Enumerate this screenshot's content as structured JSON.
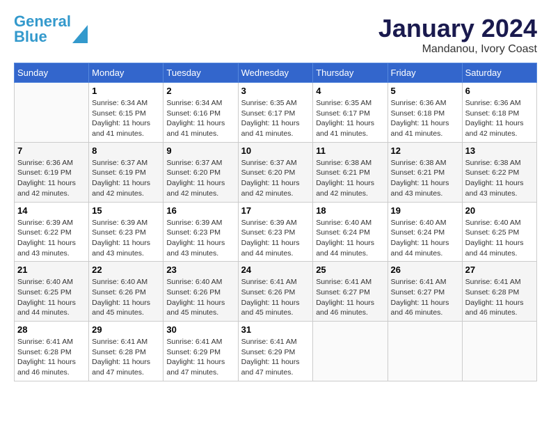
{
  "logo": {
    "line1": "General",
    "line2": "Blue"
  },
  "title": "January 2024",
  "subtitle": "Mandanou, Ivory Coast",
  "weekdays": [
    "Sunday",
    "Monday",
    "Tuesday",
    "Wednesday",
    "Thursday",
    "Friday",
    "Saturday"
  ],
  "weeks": [
    [
      {
        "day": "",
        "sunrise": "",
        "sunset": "",
        "daylight": ""
      },
      {
        "day": "1",
        "sunrise": "Sunrise: 6:34 AM",
        "sunset": "Sunset: 6:15 PM",
        "daylight": "Daylight: 11 hours and 41 minutes."
      },
      {
        "day": "2",
        "sunrise": "Sunrise: 6:34 AM",
        "sunset": "Sunset: 6:16 PM",
        "daylight": "Daylight: 11 hours and 41 minutes."
      },
      {
        "day": "3",
        "sunrise": "Sunrise: 6:35 AM",
        "sunset": "Sunset: 6:17 PM",
        "daylight": "Daylight: 11 hours and 41 minutes."
      },
      {
        "day": "4",
        "sunrise": "Sunrise: 6:35 AM",
        "sunset": "Sunset: 6:17 PM",
        "daylight": "Daylight: 11 hours and 41 minutes."
      },
      {
        "day": "5",
        "sunrise": "Sunrise: 6:36 AM",
        "sunset": "Sunset: 6:18 PM",
        "daylight": "Daylight: 11 hours and 41 minutes."
      },
      {
        "day": "6",
        "sunrise": "Sunrise: 6:36 AM",
        "sunset": "Sunset: 6:18 PM",
        "daylight": "Daylight: 11 hours and 42 minutes."
      }
    ],
    [
      {
        "day": "7",
        "sunrise": "Sunrise: 6:36 AM",
        "sunset": "Sunset: 6:19 PM",
        "daylight": "Daylight: 11 hours and 42 minutes."
      },
      {
        "day": "8",
        "sunrise": "Sunrise: 6:37 AM",
        "sunset": "Sunset: 6:19 PM",
        "daylight": "Daylight: 11 hours and 42 minutes."
      },
      {
        "day": "9",
        "sunrise": "Sunrise: 6:37 AM",
        "sunset": "Sunset: 6:20 PM",
        "daylight": "Daylight: 11 hours and 42 minutes."
      },
      {
        "day": "10",
        "sunrise": "Sunrise: 6:37 AM",
        "sunset": "Sunset: 6:20 PM",
        "daylight": "Daylight: 11 hours and 42 minutes."
      },
      {
        "day": "11",
        "sunrise": "Sunrise: 6:38 AM",
        "sunset": "Sunset: 6:21 PM",
        "daylight": "Daylight: 11 hours and 42 minutes."
      },
      {
        "day": "12",
        "sunrise": "Sunrise: 6:38 AM",
        "sunset": "Sunset: 6:21 PM",
        "daylight": "Daylight: 11 hours and 43 minutes."
      },
      {
        "day": "13",
        "sunrise": "Sunrise: 6:38 AM",
        "sunset": "Sunset: 6:22 PM",
        "daylight": "Daylight: 11 hours and 43 minutes."
      }
    ],
    [
      {
        "day": "14",
        "sunrise": "Sunrise: 6:39 AM",
        "sunset": "Sunset: 6:22 PM",
        "daylight": "Daylight: 11 hours and 43 minutes."
      },
      {
        "day": "15",
        "sunrise": "Sunrise: 6:39 AM",
        "sunset": "Sunset: 6:23 PM",
        "daylight": "Daylight: 11 hours and 43 minutes."
      },
      {
        "day": "16",
        "sunrise": "Sunrise: 6:39 AM",
        "sunset": "Sunset: 6:23 PM",
        "daylight": "Daylight: 11 hours and 43 minutes."
      },
      {
        "day": "17",
        "sunrise": "Sunrise: 6:39 AM",
        "sunset": "Sunset: 6:23 PM",
        "daylight": "Daylight: 11 hours and 44 minutes."
      },
      {
        "day": "18",
        "sunrise": "Sunrise: 6:40 AM",
        "sunset": "Sunset: 6:24 PM",
        "daylight": "Daylight: 11 hours and 44 minutes."
      },
      {
        "day": "19",
        "sunrise": "Sunrise: 6:40 AM",
        "sunset": "Sunset: 6:24 PM",
        "daylight": "Daylight: 11 hours and 44 minutes."
      },
      {
        "day": "20",
        "sunrise": "Sunrise: 6:40 AM",
        "sunset": "Sunset: 6:25 PM",
        "daylight": "Daylight: 11 hours and 44 minutes."
      }
    ],
    [
      {
        "day": "21",
        "sunrise": "Sunrise: 6:40 AM",
        "sunset": "Sunset: 6:25 PM",
        "daylight": "Daylight: 11 hours and 44 minutes."
      },
      {
        "day": "22",
        "sunrise": "Sunrise: 6:40 AM",
        "sunset": "Sunset: 6:26 PM",
        "daylight": "Daylight: 11 hours and 45 minutes."
      },
      {
        "day": "23",
        "sunrise": "Sunrise: 6:40 AM",
        "sunset": "Sunset: 6:26 PM",
        "daylight": "Daylight: 11 hours and 45 minutes."
      },
      {
        "day": "24",
        "sunrise": "Sunrise: 6:41 AM",
        "sunset": "Sunset: 6:26 PM",
        "daylight": "Daylight: 11 hours and 45 minutes."
      },
      {
        "day": "25",
        "sunrise": "Sunrise: 6:41 AM",
        "sunset": "Sunset: 6:27 PM",
        "daylight": "Daylight: 11 hours and 46 minutes."
      },
      {
        "day": "26",
        "sunrise": "Sunrise: 6:41 AM",
        "sunset": "Sunset: 6:27 PM",
        "daylight": "Daylight: 11 hours and 46 minutes."
      },
      {
        "day": "27",
        "sunrise": "Sunrise: 6:41 AM",
        "sunset": "Sunset: 6:28 PM",
        "daylight": "Daylight: 11 hours and 46 minutes."
      }
    ],
    [
      {
        "day": "28",
        "sunrise": "Sunrise: 6:41 AM",
        "sunset": "Sunset: 6:28 PM",
        "daylight": "Daylight: 11 hours and 46 minutes."
      },
      {
        "day": "29",
        "sunrise": "Sunrise: 6:41 AM",
        "sunset": "Sunset: 6:28 PM",
        "daylight": "Daylight: 11 hours and 47 minutes."
      },
      {
        "day": "30",
        "sunrise": "Sunrise: 6:41 AM",
        "sunset": "Sunset: 6:29 PM",
        "daylight": "Daylight: 11 hours and 47 minutes."
      },
      {
        "day": "31",
        "sunrise": "Sunrise: 6:41 AM",
        "sunset": "Sunset: 6:29 PM",
        "daylight": "Daylight: 11 hours and 47 minutes."
      },
      {
        "day": "",
        "sunrise": "",
        "sunset": "",
        "daylight": ""
      },
      {
        "day": "",
        "sunrise": "",
        "sunset": "",
        "daylight": ""
      },
      {
        "day": "",
        "sunrise": "",
        "sunset": "",
        "daylight": ""
      }
    ]
  ]
}
